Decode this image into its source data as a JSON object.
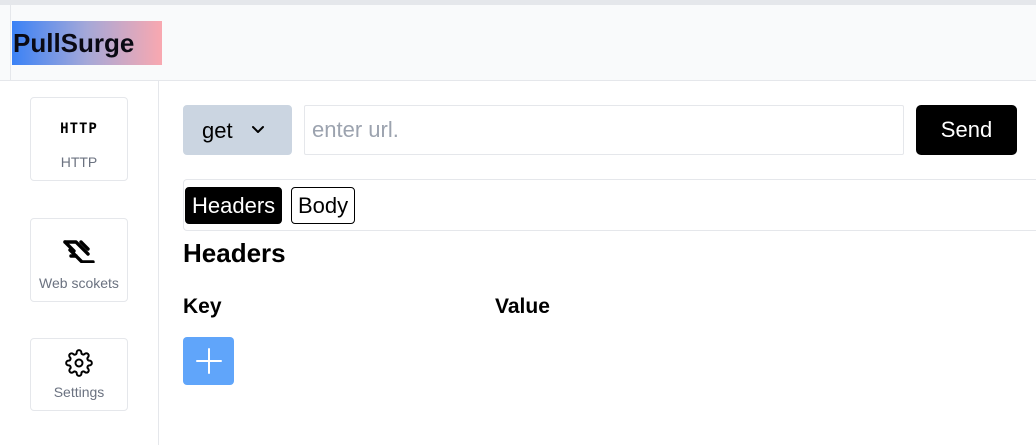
{
  "app": {
    "title": "PullSurge"
  },
  "sidebar": {
    "items": [
      {
        "label": "HTTP",
        "icon_text": "HTTP",
        "icon": "http-icon"
      },
      {
        "label": "Web scokets",
        "icon": "websocket-icon"
      },
      {
        "label": "Settings",
        "icon": "gear-icon"
      }
    ]
  },
  "request": {
    "method": "get",
    "url_value": "",
    "url_placeholder": "enter url.",
    "send_label": "Send"
  },
  "tabs": [
    {
      "label": "Headers",
      "active": true
    },
    {
      "label": "Body",
      "active": false
    }
  ],
  "headers_section": {
    "title": "Headers",
    "columns": {
      "key": "Key",
      "value": "Value"
    },
    "add_icon": "plus-icon"
  },
  "colors": {
    "send_bg": "#000000",
    "method_bg": "#cbd5e1",
    "add_button_bg": "#60a5fa",
    "logo_gradient": [
      "#3b82f6",
      "#f9a8b0"
    ]
  }
}
